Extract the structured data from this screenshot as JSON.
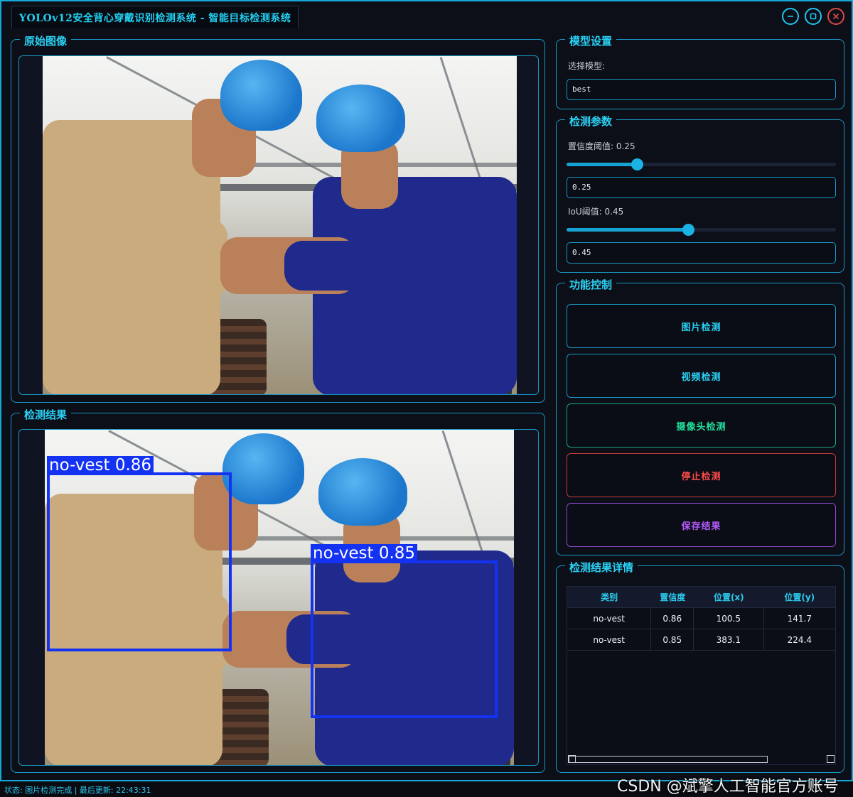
{
  "window": {
    "title": "YOLOv12安全背心穿戴识别检测系统 - 智能目标检测系统",
    "minimize_icon": "minimize-icon",
    "maximize_icon": "maximize-icon",
    "close_icon": "close-icon",
    "accent_color": "#14a9d6"
  },
  "original_panel": {
    "title": "原始图像"
  },
  "result_panel": {
    "title": "检测结果",
    "detections": [
      {
        "label": "no-vest 0.86"
      },
      {
        "label": "no-vest 0.85"
      }
    ],
    "box_color": "#1432f2"
  },
  "model_settings": {
    "title": "模型设置",
    "select_label": "选择模型:",
    "model_value": "best"
  },
  "params": {
    "title": "检测参数",
    "confidence_label": "置信度阈值: 0.25",
    "confidence_value": "0.25",
    "confidence_level": 0.25,
    "iou_label": "IoU阈值: 0.45",
    "iou_value": "0.45",
    "iou_level": 0.45
  },
  "controls": {
    "title": "功能控制",
    "image_detect": "图片检测",
    "video_detect": "视频检测",
    "camera_detect": "摄像头检测",
    "stop_detect": "停止检测",
    "save_result": "保存结果",
    "colors": {
      "image": "#2ad2f6",
      "video": "#2ad2f6",
      "camera": "#22e09c",
      "stop": "#ff4a4a",
      "save": "#b45cff"
    }
  },
  "details": {
    "title": "检测结果详情",
    "columns": [
      "类别",
      "置信度",
      "位置(x)",
      "位置(y)"
    ],
    "rows": [
      [
        "no-vest",
        "0.86",
        "100.5",
        "141.7"
      ],
      [
        "no-vest",
        "0.85",
        "383.1",
        "224.4"
      ]
    ]
  },
  "status": {
    "text": "状态: 图片检测完成 | 最后更新: 22:43:31"
  },
  "watermark": "CSDN @斌擎人工智能官方账号"
}
